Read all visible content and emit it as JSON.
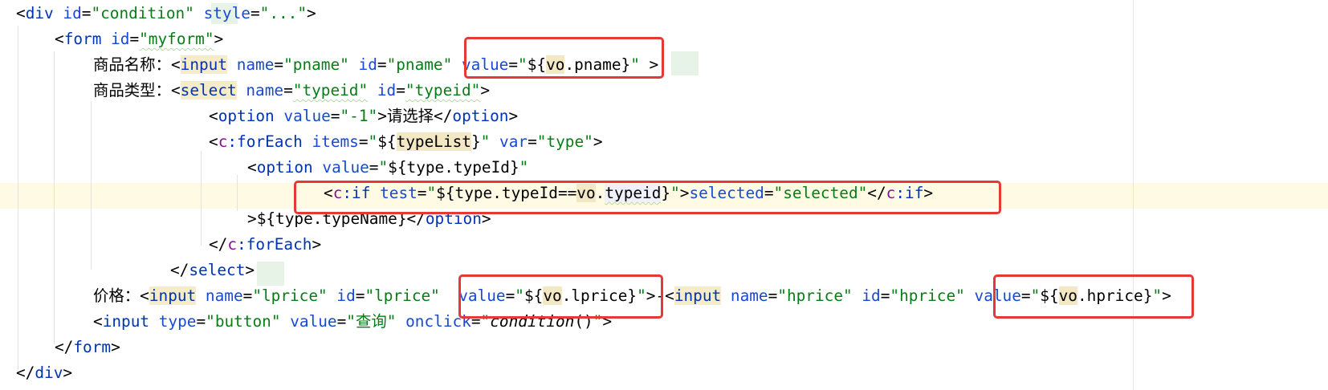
{
  "editor": {
    "lines": [
      {
        "segments": [
          {
            "c": "t",
            "s": "<"
          },
          {
            "c": "tag",
            "s": "div"
          },
          {
            "c": "t",
            "s": " "
          },
          {
            "c": "attr",
            "s": "id"
          },
          {
            "c": "t",
            "s": "="
          },
          {
            "c": "val",
            "s": "\"condition\""
          },
          {
            "c": "t",
            "s": " "
          },
          {
            "c": "attr",
            "s": "style"
          },
          {
            "c": "t",
            "s": "="
          },
          {
            "c": "val",
            "s": "\""
          },
          {
            "c": "val",
            "s": "...",
            "x": "fold"
          },
          {
            "c": "val",
            "s": "\""
          },
          {
            "c": "t",
            "s": ">"
          }
        ]
      },
      {
        "segments": [
          {
            "c": "t",
            "s": "<"
          },
          {
            "c": "tag",
            "s": "form"
          },
          {
            "c": "t",
            "s": " "
          },
          {
            "c": "attr",
            "s": "id"
          },
          {
            "c": "t",
            "s": "="
          },
          {
            "c": "val",
            "s": "\"myform\"",
            "x": "wavy"
          },
          {
            "c": "t",
            "s": ">"
          }
        ]
      },
      {
        "segments": [
          {
            "c": "t",
            "s": "商品名称："
          },
          {
            "c": "t",
            "s": "<"
          },
          {
            "c": "tag",
            "s": "input",
            "x": "hl-tag"
          },
          {
            "c": "t",
            "s": " "
          },
          {
            "c": "attr",
            "s": "name"
          },
          {
            "c": "t",
            "s": "="
          },
          {
            "c": "val",
            "s": "\"pname\""
          },
          {
            "c": "t",
            "s": " "
          },
          {
            "c": "attr",
            "s": "id"
          },
          {
            "c": "t",
            "s": "="
          },
          {
            "c": "val",
            "s": "\"pname\""
          },
          {
            "c": "t",
            "s": " "
          },
          {
            "c": "attr",
            "s": "value"
          },
          {
            "c": "t",
            "s": "="
          },
          {
            "c": "val",
            "s": "\""
          },
          {
            "c": "el",
            "s": "${"
          },
          {
            "c": "el",
            "s": "vo",
            "x": "hl-el"
          },
          {
            "c": "el",
            "s": ".pname"
          },
          {
            "c": "el",
            "s": "}"
          },
          {
            "c": "val",
            "s": "\""
          },
          {
            "c": "t",
            "s": " >"
          }
        ]
      },
      {
        "segments": [
          {
            "c": "t",
            "s": "商品类型："
          },
          {
            "c": "t",
            "s": "<"
          },
          {
            "c": "tag",
            "s": "select",
            "x": "hl-tag"
          },
          {
            "c": "t",
            "s": " "
          },
          {
            "c": "attr",
            "s": "name"
          },
          {
            "c": "t",
            "s": "="
          },
          {
            "c": "val",
            "s": "\"typeid\"",
            "x": "wavy"
          },
          {
            "c": "t",
            "s": " "
          },
          {
            "c": "attr",
            "s": "id"
          },
          {
            "c": "t",
            "s": "="
          },
          {
            "c": "val",
            "s": "\"typeid\"",
            "x": "wavy"
          },
          {
            "c": "t",
            "s": ">"
          }
        ]
      },
      {
        "segments": [
          {
            "c": "t",
            "s": "<"
          },
          {
            "c": "tag",
            "s": "option"
          },
          {
            "c": "t",
            "s": " "
          },
          {
            "c": "attr",
            "s": "value"
          },
          {
            "c": "t",
            "s": "="
          },
          {
            "c": "val",
            "s": "\"-1\""
          },
          {
            "c": "t",
            "s": ">请选择</"
          },
          {
            "c": "tag",
            "s": "option"
          },
          {
            "c": "t",
            "s": ">"
          }
        ]
      },
      {
        "segments": [
          {
            "c": "t",
            "s": "<"
          },
          {
            "c": "ns",
            "s": "c"
          },
          {
            "c": "tag",
            "s": ":forEach"
          },
          {
            "c": "t",
            "s": " "
          },
          {
            "c": "attr",
            "s": "items"
          },
          {
            "c": "t",
            "s": "="
          },
          {
            "c": "val",
            "s": "\""
          },
          {
            "c": "el",
            "s": "${"
          },
          {
            "c": "el",
            "s": "typeList",
            "x": "hl-el"
          },
          {
            "c": "el",
            "s": "}"
          },
          {
            "c": "val",
            "s": "\""
          },
          {
            "c": "t",
            "s": " "
          },
          {
            "c": "attr",
            "s": "var"
          },
          {
            "c": "t",
            "s": "="
          },
          {
            "c": "val",
            "s": "\"type\""
          },
          {
            "c": "t",
            "s": ">"
          }
        ]
      },
      {
        "segments": [
          {
            "c": "t",
            "s": "<"
          },
          {
            "c": "tag",
            "s": "option"
          },
          {
            "c": "t",
            "s": " "
          },
          {
            "c": "attr",
            "s": "value"
          },
          {
            "c": "t",
            "s": "="
          },
          {
            "c": "val",
            "s": "\""
          },
          {
            "c": "el",
            "s": "${"
          },
          {
            "c": "el",
            "s": "type.typeId"
          },
          {
            "c": "el",
            "s": "}"
          },
          {
            "c": "val",
            "s": "\""
          }
        ]
      },
      {
        "segments": [
          {
            "c": "t",
            "s": "<"
          },
          {
            "c": "ns",
            "s": "c"
          },
          {
            "c": "tag",
            "s": ":if"
          },
          {
            "c": "t",
            "s": " "
          },
          {
            "c": "attr",
            "s": "test"
          },
          {
            "c": "t",
            "s": "="
          },
          {
            "c": "val",
            "s": "\""
          },
          {
            "c": "el",
            "s": "${"
          },
          {
            "c": "el",
            "s": "type.typeId=="
          },
          {
            "c": "el",
            "s": "vo",
            "x": "hl-el"
          },
          {
            "c": "el",
            "s": "."
          },
          {
            "c": "el",
            "s": "typeid",
            "x": "hl-id wavy"
          },
          {
            "c": "el",
            "s": "}"
          },
          {
            "c": "val",
            "s": "\""
          },
          {
            "c": "t",
            "s": ">"
          },
          {
            "c": "attr",
            "s": "selected"
          },
          {
            "c": "t",
            "s": "="
          },
          {
            "c": "val",
            "s": "\"selected\""
          },
          {
            "c": "t",
            "s": "</"
          },
          {
            "c": "ns",
            "s": "c"
          },
          {
            "c": "tag",
            "s": ":if"
          },
          {
            "c": "t",
            "s": ">"
          }
        ]
      },
      {
        "segments": [
          {
            "c": "t",
            "s": ">"
          },
          {
            "c": "el",
            "s": "${"
          },
          {
            "c": "el",
            "s": "type.typeName"
          },
          {
            "c": "el",
            "s": "}"
          },
          {
            "c": "t",
            "s": "</"
          },
          {
            "c": "tag",
            "s": "option"
          },
          {
            "c": "t",
            "s": ">"
          }
        ]
      },
      {
        "segments": [
          {
            "c": "t",
            "s": "</"
          },
          {
            "c": "ns",
            "s": "c"
          },
          {
            "c": "tag",
            "s": ":forEach"
          },
          {
            "c": "t",
            "s": ">"
          }
        ]
      },
      {
        "segments": [
          {
            "c": "t",
            "s": "</"
          },
          {
            "c": "tag",
            "s": "select"
          },
          {
            "c": "t",
            "s": ">"
          }
        ]
      },
      {
        "segments": [
          {
            "c": "t",
            "s": "价格："
          },
          {
            "c": "t",
            "s": "<"
          },
          {
            "c": "tag",
            "s": "input",
            "x": "hl-tag"
          },
          {
            "c": "t",
            "s": " "
          },
          {
            "c": "attr",
            "s": "name"
          },
          {
            "c": "t",
            "s": "="
          },
          {
            "c": "val",
            "s": "\"lprice\""
          },
          {
            "c": "t",
            "s": " "
          },
          {
            "c": "attr",
            "s": "id"
          },
          {
            "c": "t",
            "s": "="
          },
          {
            "c": "val",
            "s": "\"lprice\""
          },
          {
            "c": "t",
            "s": "  "
          },
          {
            "c": "attr",
            "s": "value"
          },
          {
            "c": "t",
            "s": "="
          },
          {
            "c": "val",
            "s": "\""
          },
          {
            "c": "el",
            "s": "${"
          },
          {
            "c": "el",
            "s": "vo",
            "x": "hl-el"
          },
          {
            "c": "el",
            "s": ".lprice"
          },
          {
            "c": "el",
            "s": "}"
          },
          {
            "c": "val",
            "s": "\""
          },
          {
            "c": "t",
            "s": ">-<"
          },
          {
            "c": "tag",
            "s": "input",
            "x": "hl-tag"
          },
          {
            "c": "t",
            "s": " "
          },
          {
            "c": "attr",
            "s": "name"
          },
          {
            "c": "t",
            "s": "="
          },
          {
            "c": "val",
            "s": "\"hprice\""
          },
          {
            "c": "t",
            "s": " "
          },
          {
            "c": "attr",
            "s": "id"
          },
          {
            "c": "t",
            "s": "="
          },
          {
            "c": "val",
            "s": "\"hprice\""
          },
          {
            "c": "t",
            "s": " "
          },
          {
            "c": "attr",
            "s": "value"
          },
          {
            "c": "t",
            "s": "="
          },
          {
            "c": "val",
            "s": "\""
          },
          {
            "c": "el",
            "s": "${"
          },
          {
            "c": "el",
            "s": "vo",
            "x": "hl-el"
          },
          {
            "c": "el",
            "s": ".hprice"
          },
          {
            "c": "el",
            "s": "}"
          },
          {
            "c": "val",
            "s": "\""
          },
          {
            "c": "t",
            "s": ">"
          }
        ]
      },
      {
        "segments": [
          {
            "c": "t",
            "s": "<"
          },
          {
            "c": "tag",
            "s": "input"
          },
          {
            "c": "t",
            "s": " "
          },
          {
            "c": "attr",
            "s": "type"
          },
          {
            "c": "t",
            "s": "="
          },
          {
            "c": "val",
            "s": "\"button\""
          },
          {
            "c": "t",
            "s": " "
          },
          {
            "c": "attr",
            "s": "value"
          },
          {
            "c": "t",
            "s": "="
          },
          {
            "c": "val",
            "s": "\"查询\""
          },
          {
            "c": "t",
            "s": " "
          },
          {
            "c": "attr",
            "s": "onclick"
          },
          {
            "c": "t",
            "s": "="
          },
          {
            "c": "val",
            "s": "\""
          },
          {
            "c": "it",
            "s": "condition"
          },
          {
            "c": "el",
            "s": "()"
          },
          {
            "c": "val",
            "s": "\""
          },
          {
            "c": "t",
            "s": ">"
          }
        ]
      },
      {
        "segments": [
          {
            "c": "t",
            "s": "</"
          },
          {
            "c": "tag",
            "s": "form"
          },
          {
            "c": "t",
            "s": ">"
          }
        ]
      },
      {
        "segments": [
          {
            "c": "t",
            "s": "</"
          },
          {
            "c": "tag",
            "s": "div"
          },
          {
            "c": "t",
            "s": ">"
          }
        ]
      }
    ]
  }
}
